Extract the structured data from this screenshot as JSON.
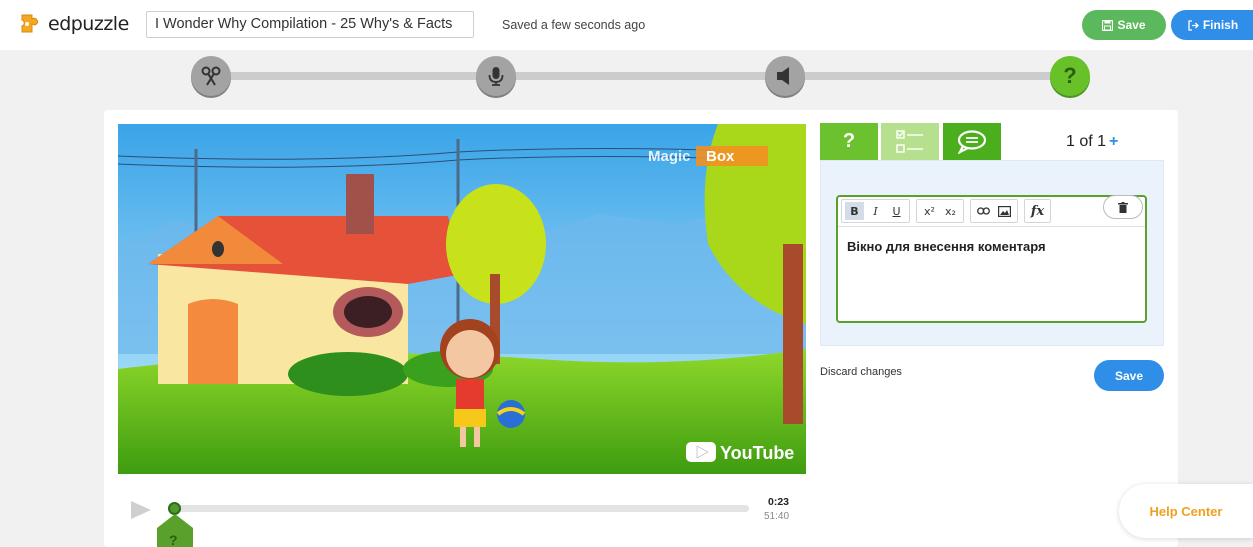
{
  "header": {
    "logo_text": "edpuzzle",
    "video_title": "I Wonder Why Compilation - 25 Why's & Facts",
    "saved_status": "Saved a few seconds ago",
    "save_label": "Save",
    "finish_label": "Finish"
  },
  "steps": [
    {
      "name": "cut",
      "icon": "scissors-icon",
      "active": false
    },
    {
      "name": "voiceover",
      "icon": "microphone-icon",
      "active": false
    },
    {
      "name": "audio-notes",
      "icon": "speaker-icon",
      "active": false
    },
    {
      "name": "questions",
      "icon": "question-icon",
      "active": true,
      "label": "?"
    }
  ],
  "video": {
    "watermark_brand": "Magic Box",
    "youtube_label": "YouTube"
  },
  "player": {
    "current_time": "0:23",
    "total_time": "51:40",
    "progress_fraction": 0.007,
    "marker_label": "?"
  },
  "question_panel": {
    "tabs": [
      {
        "name": "open-question",
        "label": "?"
      },
      {
        "name": "multiple-choice",
        "icon": "checklist-icon"
      },
      {
        "name": "comment",
        "icon": "speech-bubble-icon",
        "active": true
      }
    ],
    "counter_text": "1 of 1",
    "add_label": "+",
    "toolbar": {
      "bold": "B",
      "italic": "I",
      "underline": "U",
      "superscript": "x²",
      "subscript": "x₂",
      "formula": "fx"
    },
    "editor_text": "Вікно для внесення коментаря",
    "discard_label": "Discard changes",
    "save_label": "Save"
  },
  "help_center_label": "Help Center",
  "colors": {
    "brand_green": "#6cc12e",
    "save_green": "#5cb85c",
    "primary_blue": "#2f8fe8",
    "help_orange": "#f0a020"
  }
}
